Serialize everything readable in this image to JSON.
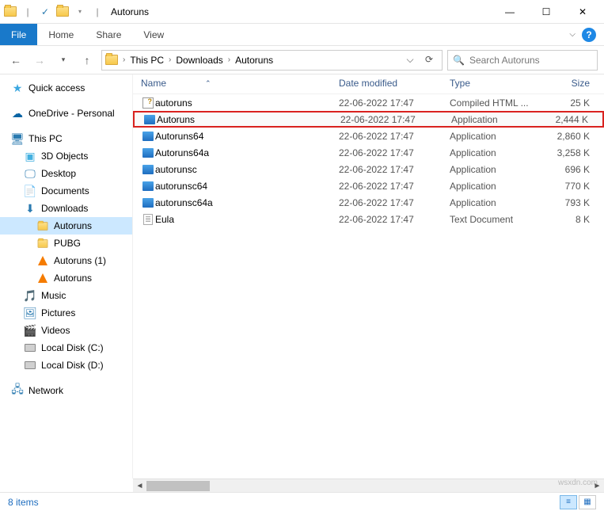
{
  "window": {
    "title": "Autoruns"
  },
  "ribbon": {
    "file": "File",
    "home": "Home",
    "share": "Share",
    "view": "View"
  },
  "breadcrumb": {
    "root": "This PC",
    "level1": "Downloads",
    "level2": "Autoruns"
  },
  "search": {
    "placeholder": "Search Autoruns"
  },
  "nav": {
    "quick_access": "Quick access",
    "onedrive": "OneDrive - Personal",
    "this_pc": "This PC",
    "objects3d": "3D Objects",
    "desktop": "Desktop",
    "documents": "Documents",
    "downloads": "Downloads",
    "autoruns_folder": "Autoruns",
    "pubg": "PUBG",
    "autoruns1": "Autoruns (1)",
    "autoruns_vlc": "Autoruns",
    "music": "Music",
    "pictures": "Pictures",
    "videos": "Videos",
    "disk_c": "Local Disk (C:)",
    "disk_d": "Local Disk (D:)",
    "network": "Network"
  },
  "columns": {
    "name": "Name",
    "date": "Date modified",
    "type": "Type",
    "size": "Size"
  },
  "files": [
    {
      "icon": "chm",
      "name": "autoruns",
      "date": "22-06-2022 17:47",
      "type": "Compiled HTML ...",
      "size": "25 K",
      "highlight": false
    },
    {
      "icon": "app",
      "name": "Autoruns",
      "date": "22-06-2022 17:47",
      "type": "Application",
      "size": "2,444 K",
      "highlight": true
    },
    {
      "icon": "app",
      "name": "Autoruns64",
      "date": "22-06-2022 17:47",
      "type": "Application",
      "size": "2,860 K",
      "highlight": false
    },
    {
      "icon": "app",
      "name": "Autoruns64a",
      "date": "22-06-2022 17:47",
      "type": "Application",
      "size": "3,258 K",
      "highlight": false
    },
    {
      "icon": "app",
      "name": "autorunsc",
      "date": "22-06-2022 17:47",
      "type": "Application",
      "size": "696 K",
      "highlight": false
    },
    {
      "icon": "app",
      "name": "autorunsc64",
      "date": "22-06-2022 17:47",
      "type": "Application",
      "size": "770 K",
      "highlight": false
    },
    {
      "icon": "app",
      "name": "autorunsc64a",
      "date": "22-06-2022 17:47",
      "type": "Application",
      "size": "793 K",
      "highlight": false
    },
    {
      "icon": "txt",
      "name": "Eula",
      "date": "22-06-2022 17:47",
      "type": "Text Document",
      "size": "8 K",
      "highlight": false
    }
  ],
  "status": {
    "items": "8 items"
  },
  "watermark": "wsxdn.com"
}
